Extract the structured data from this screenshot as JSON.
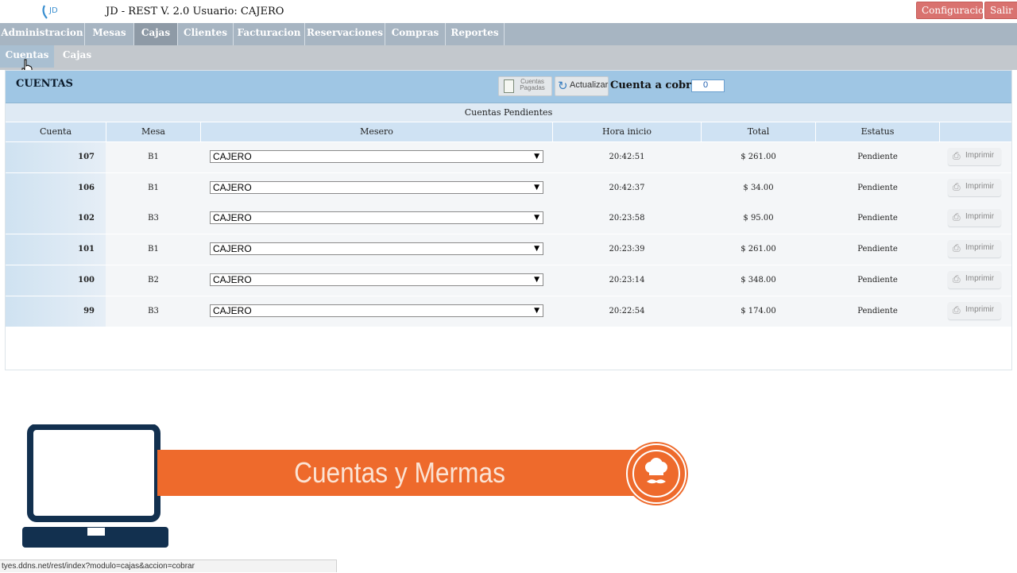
{
  "app": {
    "title": "JD - REST V. 2.0  Usuario:  CAJERO",
    "logo_text": "JD",
    "btn_config": "Configuracion",
    "btn_salir": "Salir"
  },
  "menu": [
    "Administracion",
    "Mesas",
    "Cajas",
    "Clientes",
    "Facturacion",
    "Reservaciones",
    "Compras",
    "Reportes"
  ],
  "menu_active": "Cajas",
  "submenu": [
    "Cuentas",
    "Cajas"
  ],
  "submenu_active": "Cuentas",
  "panel": {
    "title": "CUENTAS",
    "btn_pagadas": "Cuentas Pagadas",
    "btn_actualizar": "Actualizar",
    "cobrar_label": "Cuenta a cobrar:",
    "cobrar_value": "0",
    "subheader": "Cuentas Pendientes",
    "columns": [
      "Cuenta",
      "Mesa",
      "Mesero",
      "Hora inicio",
      "Total",
      "Estatus",
      ""
    ],
    "print_label": "Imprimir"
  },
  "rows": [
    {
      "cuenta": "107",
      "mesa": "B1",
      "mesero": "CAJERO",
      "hora": "20:42:51",
      "total": "$ 261.00",
      "estatus": "Pendiente"
    },
    {
      "cuenta": "106",
      "mesa": "B1",
      "mesero": "CAJERO",
      "hora": "20:42:37",
      "total": "$ 34.00",
      "estatus": "Pendiente"
    },
    {
      "cuenta": "102",
      "mesa": "B3",
      "mesero": "CAJERO",
      "hora": "20:23:58",
      "total": "$ 95.00",
      "estatus": "Pendiente"
    },
    {
      "cuenta": "101",
      "mesa": "B1",
      "mesero": "CAJERO",
      "hora": "20:23:39",
      "total": "$ 261.00",
      "estatus": "Pendiente"
    },
    {
      "cuenta": "100",
      "mesa": "B2",
      "mesero": "CAJERO",
      "hora": "20:23:14",
      "total": "$ 348.00",
      "estatus": "Pendiente"
    },
    {
      "cuenta": "99",
      "mesa": "B3",
      "mesero": "CAJERO",
      "hora": "20:22:54",
      "total": "$ 174.00",
      "estatus": "Pendiente"
    }
  ],
  "banner": {
    "text": "Cuentas y Mermas",
    "color": "#ee6a2c"
  },
  "statusbar": "tyes.ddns.net/rest/index?modulo=cajas&accion=cobrar",
  "icons": {
    "refresh": "refresh-icon",
    "print": "printer-icon",
    "document": "document-icon",
    "chef": "chef-icon",
    "laptop": "laptop-icon"
  }
}
